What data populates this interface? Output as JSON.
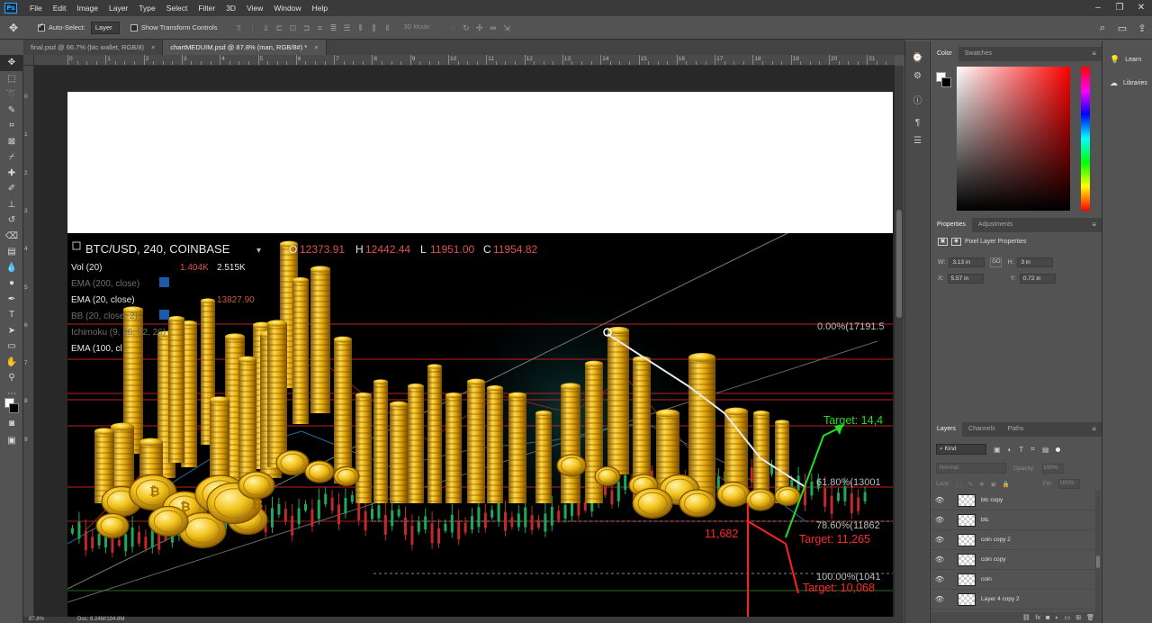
{
  "menubar": {
    "app_badge": "Ps",
    "items": [
      "File",
      "Edit",
      "Image",
      "Layer",
      "Type",
      "Select",
      "Filter",
      "3D",
      "View",
      "Window",
      "Help"
    ]
  },
  "options": {
    "auto_select_label": "Auto-Select:",
    "auto_select_value": "Layer",
    "transform_label": "Show Transform Controls",
    "mode_3d": "3D Mode:"
  },
  "tabs": [
    {
      "label": "final.psd @ 66.7% (btc wallet, RGB/8)",
      "close": "×"
    },
    {
      "label": "chartMEDUIM.psd @ 87.8% (man, RGB/8#) *",
      "close": "×"
    }
  ],
  "ruler": {
    "top_numbers": [
      "0",
      "1",
      "2",
      "3",
      "4",
      "5",
      "6",
      "7",
      "8",
      "9",
      "10",
      "11",
      "12",
      "13",
      "14",
      "15",
      "16",
      "17",
      "18",
      "19",
      "20",
      "21"
    ],
    "left_numbers": [
      "0",
      "1",
      "2",
      "3",
      "4",
      "5",
      "6",
      "7",
      "8",
      "9"
    ]
  },
  "chart": {
    "title": "BTC/USD, 240, COINBASE",
    "ohlc": {
      "o_label": "O",
      "o": "12373.91",
      "h_label": "H",
      "h": "12442.44",
      "l_label": "L",
      "l": "11951.00",
      "c_label": "C",
      "c": "11954.82"
    },
    "indicators": [
      {
        "label": "Vol (20)",
        "values": [
          "1.404K",
          "2.515K"
        ]
      },
      {
        "label": "EMA (200, close)",
        "values": []
      },
      {
        "label": "EMA (20, close)",
        "values": [
          "13827.90"
        ]
      },
      {
        "label": "BB (20, close, 2)",
        "values": []
      },
      {
        "label": "Ichimoku (9, 26, 52, 26)",
        "values": []
      },
      {
        "label": "EMA (100, cl",
        "values": []
      }
    ],
    "fib_levels": [
      {
        "label": "0.00%(17191.5"
      },
      {
        "label": "61.80%(13001"
      },
      {
        "label": "78.60%(11862"
      },
      {
        "label": "100.00%(1041"
      }
    ],
    "targets": {
      "green": "Target: 14,4",
      "red1": "Target: 11,265",
      "red2": "Target: 10,068",
      "level": "11,682"
    }
  },
  "status": {
    "zoom": "87.8%",
    "doc": "Doc: 8.24M/194.8M"
  },
  "color_panel": {
    "tabs": [
      "Color",
      "Swatches"
    ]
  },
  "properties": {
    "tabs": [
      "Properties",
      "Adjustments"
    ],
    "heading": "Pixel Layer Properties",
    "w_label": "W:",
    "w": "3.13 in",
    "link": "GO",
    "h_label": "H:",
    "h": "3 in",
    "x_label": "X:",
    "x": "5.57 in",
    "y_label": "Y:",
    "y": "0.72 in"
  },
  "layers": {
    "tabs": [
      "Layers",
      "Channels",
      "Paths"
    ],
    "kind": "Kind",
    "blend": "Normal",
    "opacity_label": "Opacity:",
    "opacity": "100%",
    "lock_label": "Lock:",
    "fill_label": "Fill:",
    "fill": "100%",
    "items": [
      "btc copy",
      "btc",
      "coin copy 2",
      "coin copy",
      "coin",
      "Layer 4 copy 2"
    ]
  },
  "learn": {
    "items": [
      "Learn",
      "Libraries"
    ]
  },
  "colors": {
    "accent": "#31a8ff",
    "green": "#22dd22",
    "red": "#ff2020",
    "fib": "#c8c8c8"
  }
}
